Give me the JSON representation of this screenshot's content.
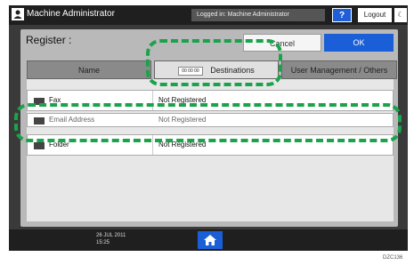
{
  "header": {
    "admin_name": "Machine Administrator",
    "login_status": "Logged in: Machine Administrator",
    "help_label": "?",
    "logout_label": "Logout",
    "moon_label": "☾"
  },
  "panel": {
    "title": "Register :",
    "cancel_label": "Cancel",
    "ok_label": "OK"
  },
  "tabs": [
    {
      "label": "Name",
      "active": false
    },
    {
      "code": "00 00 00",
      "label": "Destinations",
      "active": true
    },
    {
      "label": "User Management / Others",
      "active": false
    }
  ],
  "rows": [
    {
      "icon": "fax-icon",
      "label": "Fax",
      "value": "Not Registered"
    },
    {
      "icon": "email-icon",
      "label": "Email Address",
      "value": "Not Registered"
    },
    {
      "icon": "folder-icon",
      "label": "Folder",
      "value": "Not Registered"
    }
  ],
  "footer": {
    "date_line1": "26 JUL 2011",
    "date_line2": "15:25"
  },
  "figure_code": "DZC136",
  "colors": {
    "highlight": "#1aa34a",
    "ok_blue": "#1a5fd7",
    "header_bg": "#1f1f1f"
  }
}
